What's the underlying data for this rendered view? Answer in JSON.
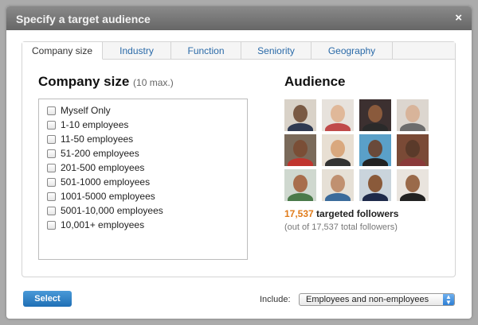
{
  "dialog": {
    "title": "Specify a target audience",
    "close": "×"
  },
  "tabs": [
    "Company size",
    "Industry",
    "Function",
    "Seniority",
    "Geography"
  ],
  "company": {
    "heading": "Company size",
    "hint": "(10 max.)",
    "options": [
      "Myself Only",
      "1-10 employees",
      "11-50 employees",
      "51-200 employees",
      "201-500 employees",
      "501-1000 employees",
      "1001-5000 employees",
      "5001-10,000 employees",
      "10,001+ employees"
    ]
  },
  "audience": {
    "heading": "Audience",
    "count": "17,537",
    "count_label": " targeted followers",
    "total": "(out of 17,537 total followers)",
    "photos": [
      [
        "#d9d2c8",
        "#7a5a44",
        "#2f3a52"
      ],
      [
        "#e7e2dc",
        "#e0b899",
        "#c04a4a"
      ],
      [
        "#3c3030",
        "#8a5a3c",
        "#2a2a2a"
      ],
      [
        "#dcd6cf",
        "#d8b49a",
        "#6d6d6d"
      ],
      [
        "#7a6a5a",
        "#7a4e36",
        "#c0352e"
      ],
      [
        "#e8dfd3",
        "#d9a87e",
        "#333"
      ],
      [
        "#5aa0c8",
        "#6a4a3a",
        "#222"
      ],
      [
        "#7a4a36",
        "#5a3a2a",
        "#8a3a3a"
      ],
      [
        "#cfd8cf",
        "#a86e4c",
        "#4a7a4a"
      ],
      [
        "#e6e0d6",
        "#c09070",
        "#3b6b9b"
      ],
      [
        "#cad4dc",
        "#8a5a3a",
        "#1e2a4a"
      ],
      [
        "#e9e4de",
        "#9a6a4a",
        "#222"
      ]
    ]
  },
  "footer": {
    "select": "Select",
    "include_label": "Include:",
    "include_value": "Employees and non-employees"
  }
}
